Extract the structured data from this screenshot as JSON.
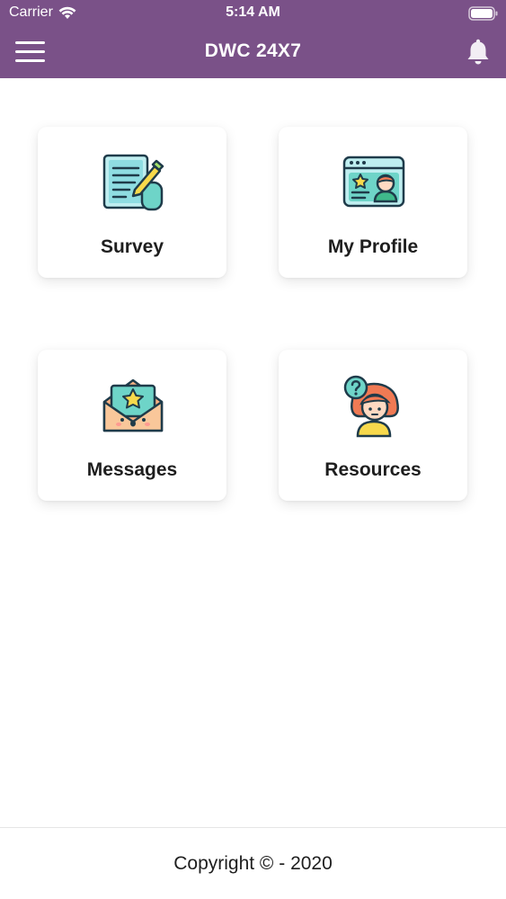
{
  "status_bar": {
    "carrier": "Carrier",
    "time": "5:14 AM",
    "icons": [
      "wifi-icon",
      "battery-icon"
    ]
  },
  "header": {
    "title": "DWC 24X7",
    "menu_icon": "hamburger-menu-icon",
    "notification_icon": "bell-icon",
    "background_color": "#7a5188"
  },
  "menu_tiles": [
    {
      "label": "Survey",
      "icon": "survey-document-icon"
    },
    {
      "label": "My Profile",
      "icon": "profile-card-icon"
    },
    {
      "label": "Messages",
      "icon": "envelope-star-icon"
    },
    {
      "label": "Resources",
      "icon": "question-girl-icon"
    }
  ],
  "footer": {
    "copyright": "Copyright © - 2020"
  }
}
